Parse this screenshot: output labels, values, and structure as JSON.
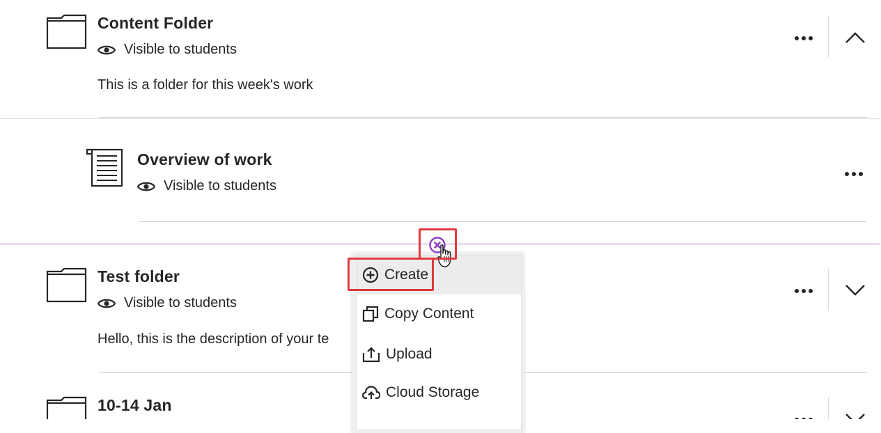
{
  "items": [
    {
      "title": "Content Folder",
      "visibility": "Visible to students",
      "description": "This is a folder for this week's work",
      "icon": "folder-icon",
      "expanded": true
    },
    {
      "title": "Overview of work",
      "visibility": "Visible to students",
      "icon": "document-icon"
    },
    {
      "title": "Test folder",
      "visibility": "Visible to students",
      "description": "Hello, this is the description of your te",
      "icon": "folder-icon",
      "expanded": false
    },
    {
      "title": "10-14 Jan",
      "icon": "folder-icon",
      "expanded": false
    }
  ],
  "add_menu": {
    "items": [
      {
        "label": "Create",
        "icon": "plus-circle-icon"
      },
      {
        "label": "Copy Content",
        "icon": "copy-icon"
      },
      {
        "label": "Upload",
        "icon": "upload-icon"
      },
      {
        "label": "Cloud Storage",
        "icon": "cloud-upload-icon"
      }
    ]
  },
  "colors": {
    "accent": "#8e3cc2",
    "highlight": "#e0393e",
    "text": "#262626",
    "divider": "#cdcdcd"
  }
}
